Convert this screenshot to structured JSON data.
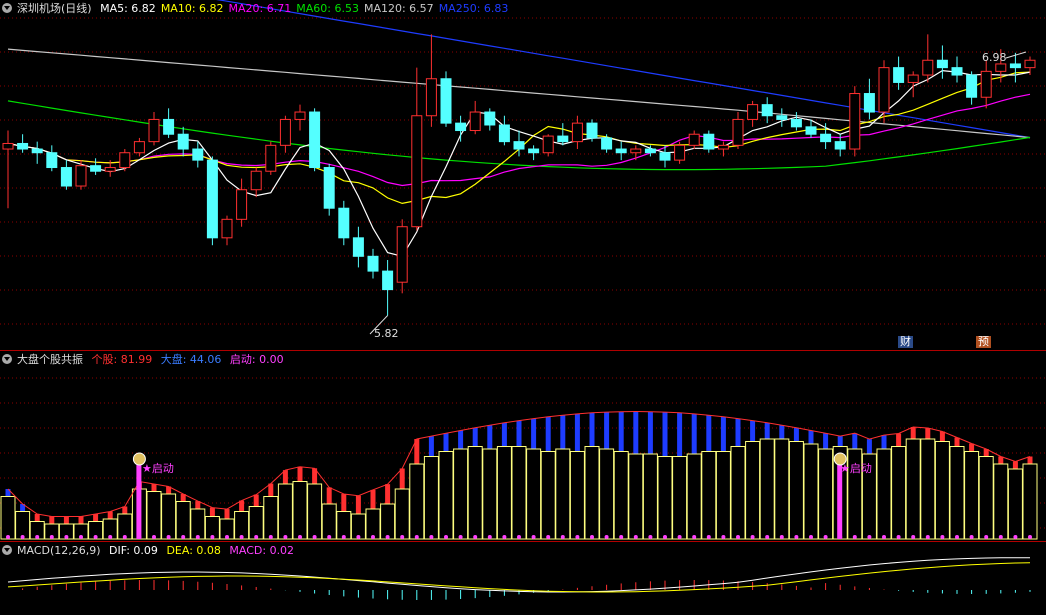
{
  "main": {
    "title": "深圳机场(日线)",
    "indicators": [
      {
        "label": "MA5: 6.82",
        "color": "#ffffff"
      },
      {
        "label": "MA10: 6.82",
        "color": "#ffff00"
      },
      {
        "label": "MA20: 6.71",
        "color": "#ff00ff"
      },
      {
        "label": "MA60: 6.53",
        "color": "#00e000"
      },
      {
        "label": "MA120: 6.57",
        "color": "#c8c8c8"
      },
      {
        "label": "MA250: 6.83",
        "color": "#1e3cff"
      }
    ],
    "high_label": "6.98",
    "low_label": "5.82",
    "marker_fin": "财",
    "marker_pre": "预"
  },
  "resonance": {
    "title": "大盘个股共振",
    "stock_label": "个股: 81.99",
    "market_label": "大盘: 44.06",
    "start_label": "启动: 0.00",
    "signal_text": "启动",
    "signal_icon": "money-bag-icon"
  },
  "macd": {
    "title": "MACD(12,26,9)",
    "dif_label": "DIF: 0.09",
    "dea_label": "DEA: 0.08",
    "macd_label": "MACD: 0.02"
  },
  "colors": {
    "up": "#ff3030",
    "down": "#54ffff",
    "grid": "#8b0000",
    "stock": "#ffff80",
    "market": "#1e3cff",
    "signal": "#ff40ff"
  },
  "chart_data": [
    {
      "type": "candlestick",
      "series": [
        {
          "name": "MA250",
          "values": []
        },
        {
          "name": "MA120",
          "values": []
        }
      ],
      "candles": [
        [
          6.72,
          6.82,
          6.4,
          6.75
        ],
        [
          6.75,
          6.8,
          6.7,
          6.72
        ],
        [
          6.72,
          6.76,
          6.64,
          6.7
        ],
        [
          6.7,
          6.74,
          6.6,
          6.62
        ],
        [
          6.62,
          6.66,
          6.5,
          6.52
        ],
        [
          6.52,
          6.66,
          6.5,
          6.63
        ],
        [
          6.63,
          6.67,
          6.58,
          6.6
        ],
        [
          6.6,
          6.66,
          6.57,
          6.62
        ],
        [
          6.62,
          6.72,
          6.6,
          6.7
        ],
        [
          6.7,
          6.78,
          6.68,
          6.76
        ],
        [
          6.76,
          6.92,
          6.74,
          6.88
        ],
        [
          6.88,
          6.94,
          6.78,
          6.8
        ],
        [
          6.8,
          6.84,
          6.68,
          6.72
        ],
        [
          6.72,
          6.76,
          6.62,
          6.66
        ],
        [
          6.66,
          6.68,
          6.2,
          6.24
        ],
        [
          6.24,
          6.36,
          6.2,
          6.34
        ],
        [
          6.34,
          6.56,
          6.3,
          6.5
        ],
        [
          6.5,
          6.62,
          6.46,
          6.6
        ],
        [
          6.6,
          6.76,
          6.58,
          6.74
        ],
        [
          6.74,
          6.9,
          6.7,
          6.88
        ],
        [
          6.88,
          6.96,
          6.82,
          6.92
        ],
        [
          6.92,
          6.94,
          6.6,
          6.62
        ],
        [
          6.62,
          6.64,
          6.36,
          6.4
        ],
        [
          6.4,
          6.44,
          6.2,
          6.24
        ],
        [
          6.24,
          6.3,
          6.08,
          6.14
        ],
        [
          6.14,
          6.18,
          6.02,
          6.06
        ],
        [
          6.06,
          6.12,
          5.82,
          5.96
        ],
        [
          6.0,
          6.34,
          5.94,
          6.3
        ],
        [
          6.3,
          7.16,
          6.28,
          6.9
        ],
        [
          6.9,
          7.34,
          6.84,
          7.1
        ],
        [
          7.1,
          7.14,
          6.84,
          6.86
        ],
        [
          6.86,
          6.9,
          6.76,
          6.82
        ],
        [
          6.82,
          6.98,
          6.8,
          6.92
        ],
        [
          6.92,
          6.94,
          6.82,
          6.85
        ],
        [
          6.85,
          6.9,
          6.74,
          6.76
        ],
        [
          6.76,
          6.82,
          6.68,
          6.72
        ],
        [
          6.72,
          6.74,
          6.66,
          6.7
        ],
        [
          6.7,
          6.8,
          6.68,
          6.79
        ],
        [
          6.79,
          6.86,
          6.74,
          6.76
        ],
        [
          6.76,
          6.9,
          6.72,
          6.86
        ],
        [
          6.86,
          6.88,
          6.76,
          6.78
        ],
        [
          6.78,
          6.8,
          6.7,
          6.72
        ],
        [
          6.72,
          6.76,
          6.66,
          6.7
        ],
        [
          6.7,
          6.74,
          6.66,
          6.72
        ],
        [
          6.72,
          6.74,
          6.68,
          6.7
        ],
        [
          6.7,
          6.74,
          6.62,
          6.66
        ],
        [
          6.66,
          6.76,
          6.64,
          6.74
        ],
        [
          6.74,
          6.82,
          6.72,
          6.8
        ],
        [
          6.8,
          6.82,
          6.7,
          6.72
        ],
        [
          6.72,
          6.76,
          6.68,
          6.74
        ],
        [
          6.74,
          6.92,
          6.72,
          6.88
        ],
        [
          6.88,
          6.98,
          6.84,
          6.96
        ],
        [
          6.96,
          7.0,
          6.86,
          6.9
        ],
        [
          6.9,
          6.94,
          6.84,
          6.88
        ],
        [
          6.88,
          6.92,
          6.82,
          6.84
        ],
        [
          6.84,
          6.88,
          6.78,
          6.8
        ],
        [
          6.8,
          6.86,
          6.72,
          6.76
        ],
        [
          6.76,
          6.8,
          6.68,
          6.72
        ],
        [
          6.72,
          7.06,
          6.68,
          7.02
        ],
        [
          7.02,
          7.1,
          6.88,
          6.92
        ],
        [
          6.92,
          7.2,
          6.86,
          7.16
        ],
        [
          7.16,
          7.22,
          7.04,
          7.08
        ],
        [
          7.08,
          7.14,
          7.0,
          7.12
        ],
        [
          7.12,
          7.34,
          7.08,
          7.2
        ],
        [
          7.2,
          7.28,
          7.1,
          7.16
        ],
        [
          7.16,
          7.22,
          7.08,
          7.12
        ],
        [
          7.12,
          7.14,
          6.96,
          7.0
        ],
        [
          7.0,
          7.2,
          6.94,
          7.14
        ],
        [
          7.14,
          7.26,
          7.08,
          7.18
        ],
        [
          7.18,
          7.24,
          7.08,
          7.16
        ],
        [
          7.16,
          7.22,
          7.12,
          7.2
        ]
      ],
      "labels": {
        "high": "6.98",
        "low": "5.82"
      }
    },
    {
      "type": "bar",
      "series": [
        {
          "name": "个股",
          "values": [
            34,
            22,
            14,
            12,
            12,
            12,
            14,
            16,
            20,
            40,
            38,
            36,
            30,
            24,
            18,
            16,
            22,
            26,
            34,
            44,
            46,
            44,
            28,
            22,
            20,
            24,
            28,
            40,
            60,
            66,
            70,
            72,
            74,
            72,
            74,
            74,
            72,
            70,
            72,
            70,
            74,
            72,
            70,
            68,
            68,
            66,
            66,
            68,
            70,
            70,
            74,
            78,
            80,
            80,
            78,
            76,
            72,
            74,
            72,
            68,
            72,
            74,
            80,
            80,
            78,
            74,
            70,
            66,
            60,
            56,
            60
          ]
        },
        {
          "name": "大盘",
          "values": [
            0,
            0,
            0,
            0,
            0,
            0,
            0,
            0,
            0,
            0,
            0,
            0,
            0,
            0,
            0,
            0,
            0,
            0,
            0,
            0,
            0,
            0,
            0,
            0,
            0,
            0,
            0,
            0,
            0,
            0,
            0,
            0,
            0,
            0,
            0,
            0,
            0,
            0,
            0,
            0,
            0,
            0,
            0,
            0,
            0,
            0,
            0,
            0,
            0,
            0,
            0,
            0,
            0,
            0,
            0,
            0,
            0,
            0,
            0,
            0,
            0,
            0,
            0,
            0,
            0,
            0,
            0,
            0,
            0,
            0,
            0
          ]
        }
      ]
    }
  ]
}
